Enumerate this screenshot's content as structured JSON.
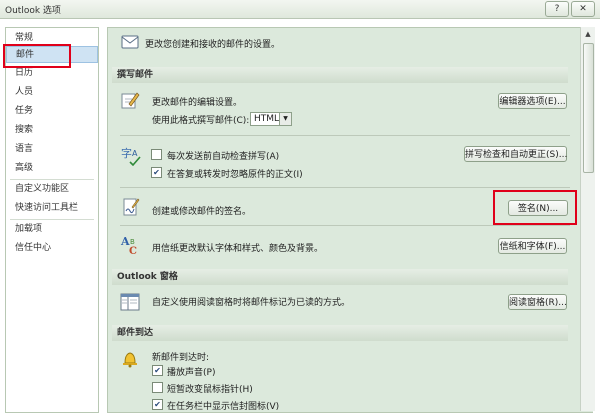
{
  "window": {
    "title": "Outlook 选项",
    "help_icon": "?",
    "close_icon": "✕"
  },
  "sidebar": {
    "items": [
      {
        "label": "常规"
      },
      {
        "label": "邮件"
      },
      {
        "label": "日历"
      },
      {
        "label": "人员"
      },
      {
        "label": "任务"
      },
      {
        "label": "搜索"
      },
      {
        "label": "语言"
      },
      {
        "label": "高级"
      },
      {
        "label": "自定义功能区"
      },
      {
        "label": "快速访问工具栏"
      },
      {
        "label": "加载项"
      },
      {
        "label": "信任中心"
      }
    ],
    "selected": "邮件"
  },
  "main": {
    "intro": "更改您创建和接收的邮件的设置。",
    "compose": {
      "header": "撰写邮件",
      "edit_text": "更改邮件的编辑设置。",
      "format_label": "使用此格式撰写邮件(C):",
      "format_value": "HTML",
      "editor_options_button": "编辑器选项(E)...",
      "spell_check_label": "每次发送前自动检查拼写(A)",
      "spell_check_checked": false,
      "ignore_original_label": "在答复或转发时忽略原件的正文(I)",
      "ignore_original_checked": true,
      "spelling_button": "拼写检查和自动更正(S)...",
      "signature_text": "创建或修改邮件的签名。",
      "signature_button": "签名(N)...",
      "stationery_text": "用信纸更改默认字体和样式、颜色及背景。",
      "stationery_button": "信纸和字体(F)..."
    },
    "reading_pane": {
      "header": "Outlook 窗格",
      "text": "自定义使用阅读窗格时将邮件标记为已读的方式。",
      "button": "阅读窗格(R)..."
    },
    "arrival": {
      "header": "邮件到达",
      "when_label": "新邮件到达时:",
      "options": [
        {
          "label": "播放声音(P)",
          "checked": true
        },
        {
          "label": "短暂改变鼠标指针(H)",
          "checked": false
        },
        {
          "label": "在任务栏中显示信封图标(V)",
          "checked": true
        }
      ]
    }
  },
  "colors": {
    "panel_bg": "#dce9dc",
    "selected_bg": "#cfe3f3",
    "highlight_red": "#e0001a"
  }
}
